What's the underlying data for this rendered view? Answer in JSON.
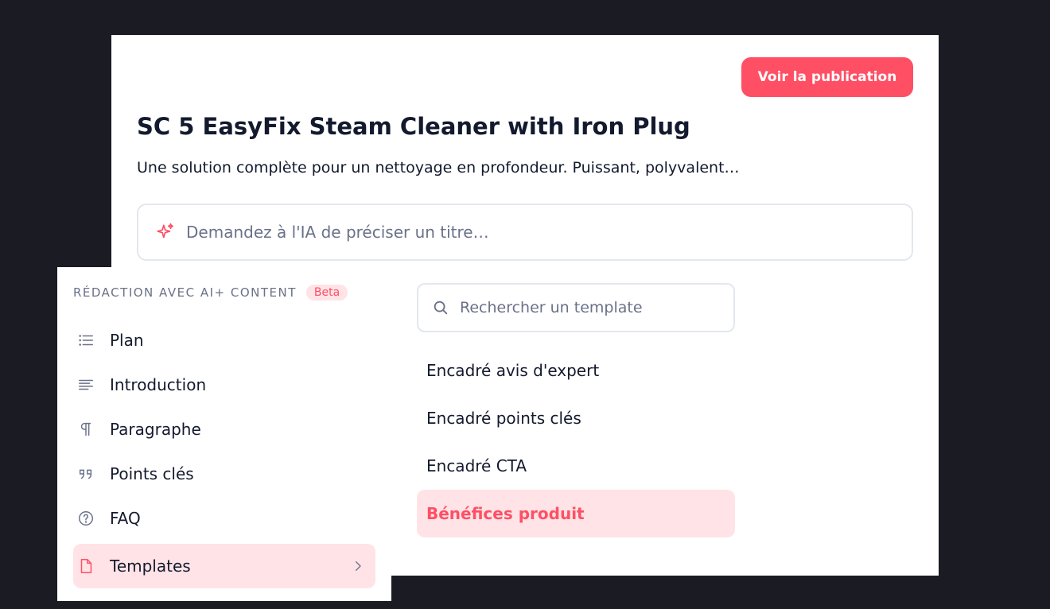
{
  "header": {
    "publish_button": "Voir la publication",
    "title": "SC 5 EasyFix Steam Cleaner with Iron Plug",
    "subtitle": "Une solution complète pour un nettoyage en profondeur. Puissant, polyvalent…"
  },
  "ai_prompt": {
    "icon": "sparkle-icon",
    "placeholder": "Demandez à l'IA de préciser un titre…"
  },
  "side_panel": {
    "section_title": "RÉDACTION AVEC AI+ CONTENT",
    "badge": "Beta",
    "items": [
      {
        "label": "Plan",
        "icon": "list-icon"
      },
      {
        "label": "Introduction",
        "icon": "text-align-icon"
      },
      {
        "label": "Paragraphe",
        "icon": "pilcrow-icon"
      },
      {
        "label": "Points clés",
        "icon": "quote-icon"
      },
      {
        "label": "FAQ",
        "icon": "help-circle-icon"
      },
      {
        "label": "Templates",
        "icon": "file-icon",
        "active": true
      }
    ]
  },
  "templates": {
    "search_placeholder": "Rechercher un template",
    "items": [
      {
        "label": "Encadré avis d'expert"
      },
      {
        "label": "Encadré points clés"
      },
      {
        "label": "Encadré CTA"
      },
      {
        "label": "Bénéfices produit",
        "active": true
      }
    ]
  },
  "colors": {
    "accent": "#ff4f64",
    "accent_soft": "#ffe3e6",
    "text": "#131a2e",
    "muted": "#6a7189",
    "background": "#1b1b24"
  }
}
